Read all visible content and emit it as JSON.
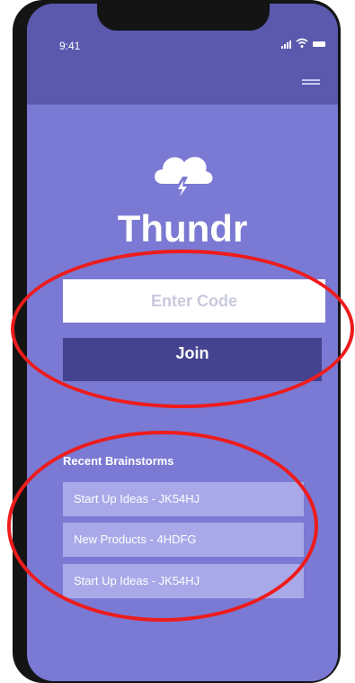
{
  "status_bar": {
    "time": "9:41"
  },
  "app": {
    "title": "Thundr"
  },
  "join_form": {
    "code_placeholder": "Enter Code",
    "join_label": "Join"
  },
  "recent": {
    "title": "Recent Brainstorms",
    "items": [
      {
        "label": "Start Up Ideas - JK54HJ"
      },
      {
        "label": "New Products - 4HDFG"
      },
      {
        "label": "Start Up Ideas - JK54HJ"
      }
    ]
  },
  "colors": {
    "background": "#7a79d3",
    "header": "#5a59ae",
    "join_button": "#44438f",
    "list_item": "#a9a9e9",
    "annotation": "#ee1c1c"
  }
}
